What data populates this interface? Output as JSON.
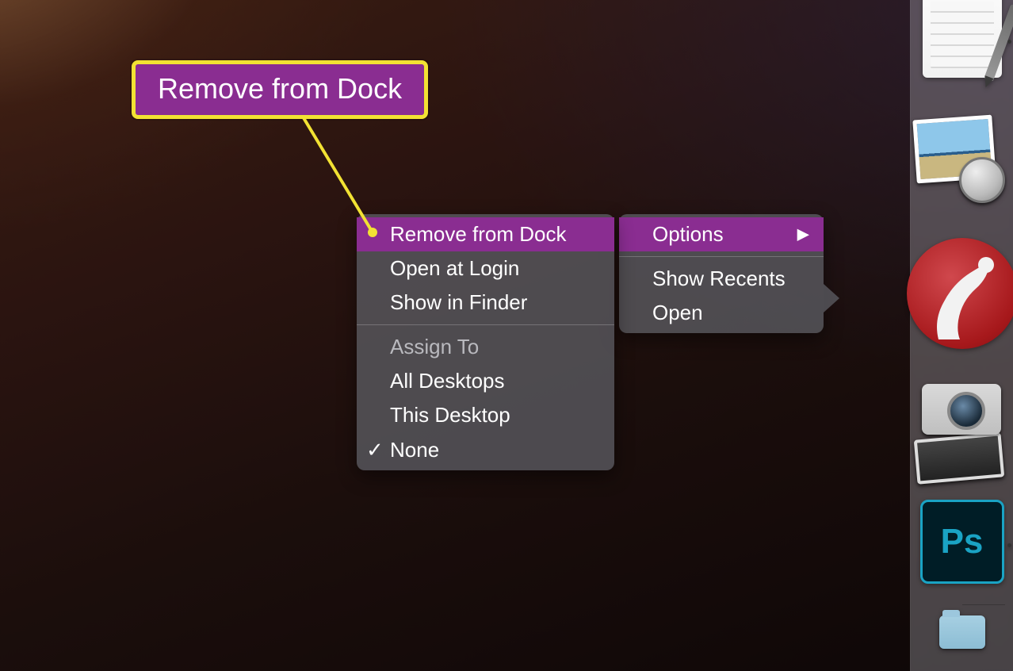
{
  "callout": {
    "label": "Remove from Dock"
  },
  "main_menu": {
    "options_label": "Options",
    "show_recents": "Show Recents",
    "open": "Open"
  },
  "options_submenu": {
    "remove_from_dock": "Remove from Dock",
    "open_at_login": "Open at Login",
    "show_in_finder": "Show in Finder",
    "assign_to": "Assign To",
    "all_desktops": "All Desktops",
    "this_desktop": "This Desktop",
    "none": "None"
  },
  "dock": {
    "items": [
      {
        "name": "textedit-icon"
      },
      {
        "name": "preview-icon"
      },
      {
        "name": "bear-icon"
      },
      {
        "name": "image-capture-icon"
      },
      {
        "name": "photoshop-icon"
      },
      {
        "name": "recent-folder-icon"
      }
    ],
    "ps_label": "Ps"
  }
}
